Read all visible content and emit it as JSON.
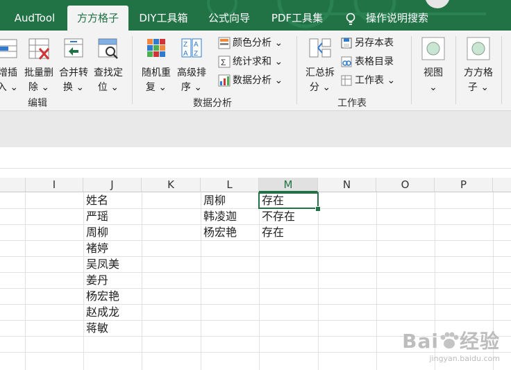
{
  "tabs": [
    "AudTool",
    "方方格子",
    "DIY工具箱",
    "公式向导",
    "PDF工具集",
    "操作说明搜索"
  ],
  "ribbon": {
    "edit_group": {
      "label": "编辑",
      "buttons": [
        {
          "line1": "增插",
          "line2": "入 ⌄"
        },
        {
          "line1": "批量删",
          "line2": "除 ⌄"
        },
        {
          "line1": "合并转",
          "line2": "换 ⌄"
        },
        {
          "line1": "查找定",
          "line2": "位 ⌄"
        }
      ]
    },
    "data_group": {
      "label": "数据分析",
      "buttons": [
        {
          "line1": "随机重",
          "line2": "复 ⌄"
        },
        {
          "line1": "高级排",
          "line2": "序 ⌄"
        }
      ],
      "small": [
        "颜色分析 ⌄",
        "统计求和 ⌄",
        "数据分析 ⌄"
      ]
    },
    "sheet_group": {
      "label": "工作表",
      "button": {
        "line1": "汇总拆",
        "line2": "分 ⌄"
      },
      "small": [
        "另存本表",
        "表格目录",
        "工作表 ⌄"
      ]
    },
    "view": {
      "line1": "视图",
      "line2": "⌄"
    },
    "fangfang": {
      "line1": "方方格",
      "line2": "子 ⌄"
    }
  },
  "columns": [
    "I",
    "J",
    "K",
    "L",
    "M",
    "N",
    "O",
    "P"
  ],
  "selected_column": "M",
  "cells": {
    "J": [
      "姓名",
      "严瑶",
      "周柳",
      "褚婷",
      "吴凤美",
      "姜丹",
      "杨宏艳",
      "赵成龙",
      "蒋敏"
    ],
    "L": [
      "周柳",
      "韩凌迦",
      "杨宏艳"
    ],
    "M": [
      "存在",
      "不存在",
      "存在"
    ]
  },
  "watermark": {
    "brand": "Bai",
    "brand2": "经验",
    "url": "jingyan.baidu.com"
  }
}
